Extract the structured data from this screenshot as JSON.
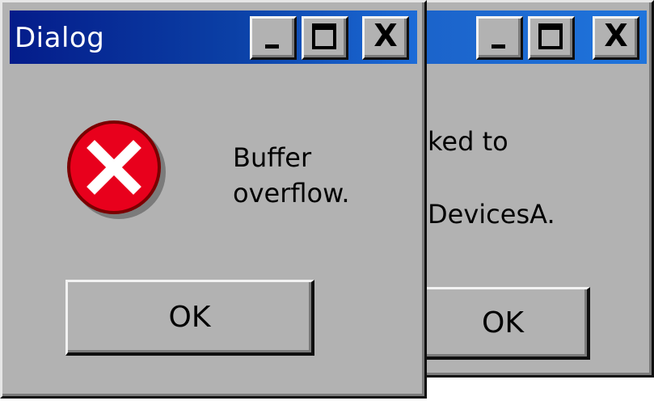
{
  "back_dialog": {
    "message_line1": "ked to",
    "message_line2": "DevicesA.",
    "ok_label": "OK",
    "min_button": "_",
    "max_button": "□",
    "close_button": "X",
    "icons": [
      "minimize-icon",
      "maximize-icon",
      "close-icon"
    ]
  },
  "front_dialog": {
    "title": "Dialog",
    "message_line1": "Buffer",
    "message_line2": "overflow.",
    "ok_label": "OK",
    "min_button": "_",
    "max_button": "□",
    "close_button": "X",
    "icons": [
      "error-icon",
      "minimize-icon",
      "maximize-icon",
      "close-icon"
    ],
    "colors": {
      "titlebar_start": "#041c8a",
      "titlebar_end": "#1c6cd8",
      "error_red": "#e8001c",
      "face": "#b2b2b2"
    }
  }
}
